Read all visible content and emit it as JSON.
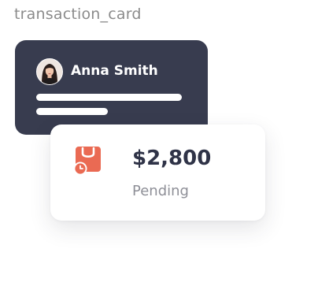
{
  "frame": {
    "title": "transaction_card"
  },
  "user_card": {
    "name": "Anna Smith",
    "avatar_icon": "user-avatar-photo",
    "background_color": "#383c4f"
  },
  "transaction": {
    "amount": "$2,800",
    "status": "Pending",
    "icon": "shopping-bag-clock-icon",
    "accent_color": "#ea6a53"
  }
}
